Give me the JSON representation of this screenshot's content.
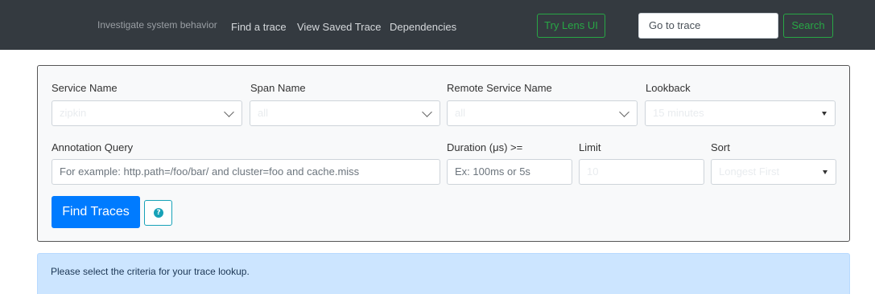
{
  "navbar": {
    "brand": "Investigate system behavior",
    "links": [
      "Find a trace",
      "View Saved Trace",
      "Dependencies"
    ],
    "lens_button": "Try Lens UI",
    "goto_input_value": "Go to trace",
    "search_button": "Search",
    "accent_color": "#28a745"
  },
  "form": {
    "service_name": {
      "label": "Service Name",
      "value": "zipkin"
    },
    "span_name": {
      "label": "Span Name",
      "value": "all"
    },
    "remote_service_name": {
      "label": "Remote Service Name",
      "value": "all"
    },
    "lookback": {
      "label": "Lookback",
      "value": "15 minutes"
    },
    "annotation_query": {
      "label": "Annotation Query",
      "placeholder": "For example: http.path=/foo/bar/ and cluster=foo and cache.miss"
    },
    "duration": {
      "label": "Duration (μs) >=",
      "placeholder": "Ex: 100ms or 5s"
    },
    "limit": {
      "label": "Limit",
      "value": "10"
    },
    "sort": {
      "label": "Sort",
      "value": "Longest First"
    },
    "find_button": "Find Traces",
    "help_icon": "question-circle-icon"
  },
  "alert": {
    "text": "Please select the criteria for your trace lookup."
  }
}
